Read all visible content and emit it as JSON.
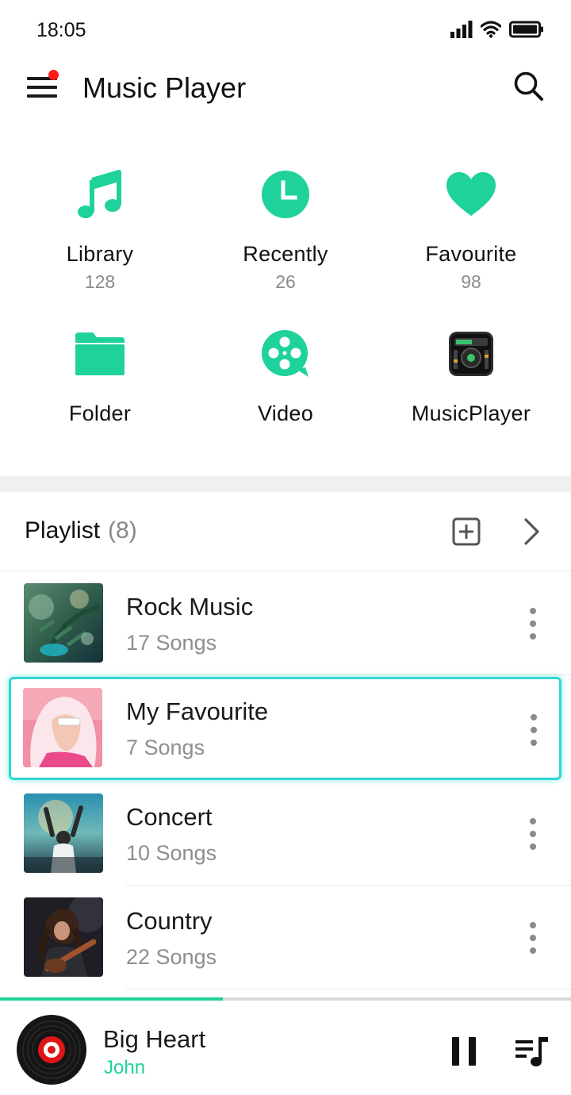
{
  "status_bar": {
    "time": "18:05"
  },
  "app_bar": {
    "title": "Music Player"
  },
  "categories": [
    {
      "label": "Library",
      "count": "128",
      "icon": "music-note-icon"
    },
    {
      "label": "Recently",
      "count": "26",
      "icon": "clock-icon"
    },
    {
      "label": "Favourite",
      "count": "98",
      "icon": "heart-icon"
    },
    {
      "label": "Folder",
      "icon": "folder-icon"
    },
    {
      "label": "Video",
      "icon": "film-reel-icon"
    },
    {
      "label": "MusicPlayer",
      "icon": "dj-deck-icon"
    }
  ],
  "playlist": {
    "title": "Playlist",
    "count": "(8)",
    "items": [
      {
        "name": "Rock Music",
        "songs": "17 Songs"
      },
      {
        "name": "My Favourite",
        "songs": "7 Songs",
        "selected": true
      },
      {
        "name": "Concert",
        "songs": "10 Songs"
      },
      {
        "name": "Country",
        "songs": "22 Songs"
      }
    ]
  },
  "now_playing": {
    "title": "Big Heart",
    "artist": "John",
    "progress": 0.39
  },
  "colors": {
    "accent": "#1FD19B",
    "selection": "#2FD9D2",
    "notification_dot": "#FF1A1A"
  }
}
